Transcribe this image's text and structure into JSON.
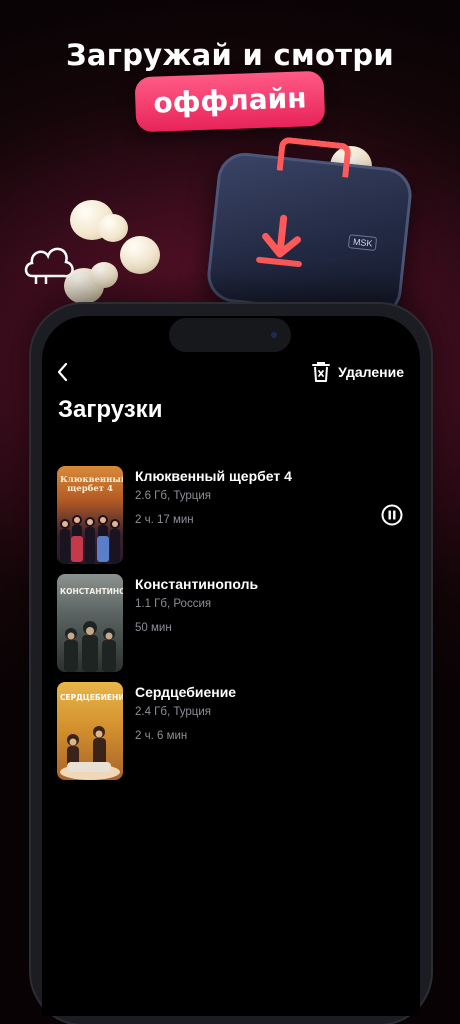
{
  "promo": {
    "headline": "Загружай и смотри",
    "highlight": "оффлайн",
    "case_label": "MSK"
  },
  "header": {
    "back_icon": "chevron-left-icon",
    "delete_label": "Удаление",
    "delete_icon": "trash-x-icon"
  },
  "page": {
    "title": "Загрузки"
  },
  "downloads": [
    {
      "title": "Клюквенный щербет 4",
      "info": "2.6 Гб, Турция",
      "duration": "2 ч. 17 мин",
      "poster_text": "Клюквенный щербет 4",
      "state": "pause-icon"
    },
    {
      "title": "Константинополь",
      "info": "1.1 Гб, Россия",
      "duration": "50 мин",
      "poster_text": "КОНСТАНТИНОПОЛЬ"
    },
    {
      "title": "Сердцебиение",
      "info": "2.4 Гб, Турция",
      "duration": "2 ч. 6 мин",
      "poster_text": "СЕРДЦЕБИЕНИЕ"
    }
  ],
  "colors": {
    "accent": "#e8245a",
    "background": "#000000",
    "secondary_text": "#8d8f97"
  }
}
